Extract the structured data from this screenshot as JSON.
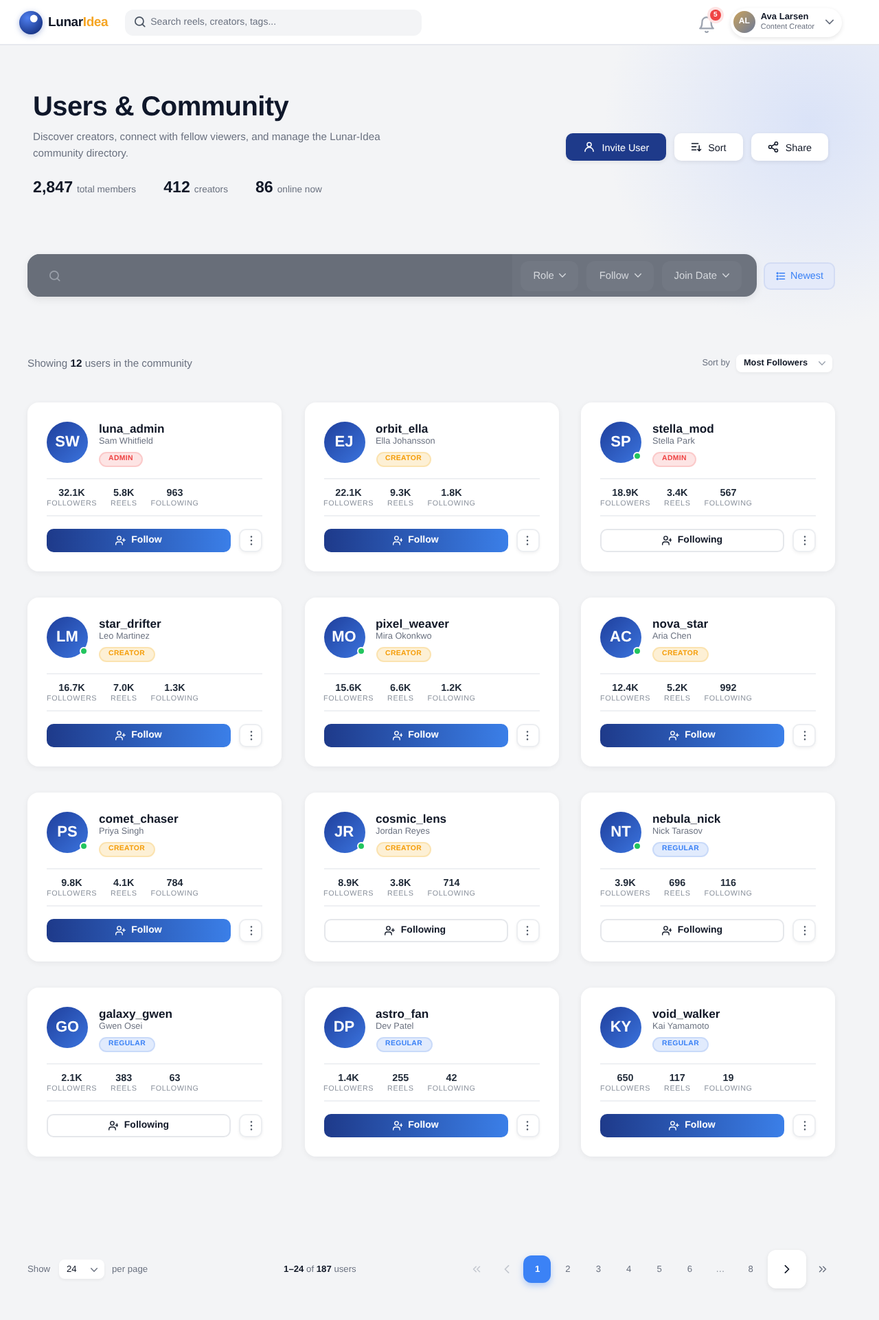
{
  "header": {
    "logo": {
      "name": "Lunar",
      "accent": "Idea"
    },
    "search": {
      "placeholder": "Search reels, creators, tags..."
    },
    "notifications": {
      "count": "5"
    },
    "user": {
      "initials": "AL",
      "name": "Ava Larsen",
      "role": "Content Creator"
    }
  },
  "hero": {
    "title": "Users & Community",
    "subtitle": "Discover creators, connect with fellow viewers, and manage the Lunar-Idea community directory.",
    "stats": [
      {
        "value": "2,847",
        "label": "total members"
      },
      {
        "value": "412",
        "label": "creators"
      },
      {
        "value": "86",
        "label": "online now"
      }
    ],
    "actions": [
      {
        "kind": "invite",
        "label": "Invite User"
      },
      {
        "kind": "sort",
        "label": "Sort"
      },
      {
        "kind": "share",
        "label": "Share"
      }
    ]
  },
  "filters": {
    "dropdowns": [
      {
        "label": "Role"
      },
      {
        "label": "Follow"
      },
      {
        "label": "Join Date"
      }
    ],
    "order_button": {
      "label": "Newest"
    }
  },
  "results": {
    "summary": "Showing **12** users in the community",
    "sort_label": "Sort by",
    "sort_value": "Most Followers"
  },
  "users": [
    {
      "initials": "SW",
      "username": "luna_admin",
      "name": "Sam Whitfield",
      "badge": {
        "label": "ADMIN",
        "kind": "admin"
      },
      "online": false,
      "stats": [
        {
          "value": "32.1K",
          "label": "FOLLOWERS"
        },
        {
          "value": "5.8K",
          "label": "REELS"
        },
        {
          "value": "963",
          "label": "FOLLOWING"
        }
      ],
      "following": false,
      "follow_label": "Follow"
    },
    {
      "initials": "EJ",
      "username": "orbit_ella",
      "name": "Ella Johansson",
      "badge": {
        "label": "CREATOR",
        "kind": "creator"
      },
      "online": false,
      "stats": [
        {
          "value": "22.1K",
          "label": "FOLLOWERS"
        },
        {
          "value": "9.3K",
          "label": "REELS"
        },
        {
          "value": "1.8K",
          "label": "FOLLOWING"
        }
      ],
      "following": false,
      "follow_label": "Follow"
    },
    {
      "initials": "SP",
      "username": "stella_mod",
      "name": "Stella Park",
      "badge": {
        "label": "ADMIN",
        "kind": "admin"
      },
      "online": true,
      "stats": [
        {
          "value": "18.9K",
          "label": "FOLLOWERS"
        },
        {
          "value": "3.4K",
          "label": "REELS"
        },
        {
          "value": "567",
          "label": "FOLLOWING"
        }
      ],
      "following": true,
      "follow_label": "Following"
    },
    {
      "initials": "LM",
      "username": "star_drifter",
      "name": "Leo Martinez",
      "badge": {
        "label": "CREATOR",
        "kind": "creator"
      },
      "online": true,
      "stats": [
        {
          "value": "16.7K",
          "label": "FOLLOWERS"
        },
        {
          "value": "7.0K",
          "label": "REELS"
        },
        {
          "value": "1.3K",
          "label": "FOLLOWING"
        }
      ],
      "following": false,
      "follow_label": "Follow"
    },
    {
      "initials": "MO",
      "username": "pixel_weaver",
      "name": "Mira Okonkwo",
      "badge": {
        "label": "CREATOR",
        "kind": "creator"
      },
      "online": true,
      "stats": [
        {
          "value": "15.6K",
          "label": "FOLLOWERS"
        },
        {
          "value": "6.6K",
          "label": "REELS"
        },
        {
          "value": "1.2K",
          "label": "FOLLOWING"
        }
      ],
      "following": false,
      "follow_label": "Follow"
    },
    {
      "initials": "AC",
      "username": "nova_star",
      "name": "Aria Chen",
      "badge": {
        "label": "CREATOR",
        "kind": "creator"
      },
      "online": true,
      "stats": [
        {
          "value": "12.4K",
          "label": "FOLLOWERS"
        },
        {
          "value": "5.2K",
          "label": "REELS"
        },
        {
          "value": "992",
          "label": "FOLLOWING"
        }
      ],
      "following": false,
      "follow_label": "Follow"
    },
    {
      "initials": "PS",
      "username": "comet_chaser",
      "name": "Priya Singh",
      "badge": {
        "label": "CREATOR",
        "kind": "creator"
      },
      "online": true,
      "stats": [
        {
          "value": "9.8K",
          "label": "FOLLOWERS"
        },
        {
          "value": "4.1K",
          "label": "REELS"
        },
        {
          "value": "784",
          "label": "FOLLOWING"
        }
      ],
      "following": false,
      "follow_label": "Follow"
    },
    {
      "initials": "JR",
      "username": "cosmic_lens",
      "name": "Jordan Reyes",
      "badge": {
        "label": "CREATOR",
        "kind": "creator"
      },
      "online": true,
      "stats": [
        {
          "value": "8.9K",
          "label": "FOLLOWERS"
        },
        {
          "value": "3.8K",
          "label": "REELS"
        },
        {
          "value": "714",
          "label": "FOLLOWING"
        }
      ],
      "following": true,
      "follow_label": "Following"
    },
    {
      "initials": "NT",
      "username": "nebula_nick",
      "name": "Nick Tarasov",
      "badge": {
        "label": "REGULAR",
        "kind": "regular"
      },
      "online": true,
      "stats": [
        {
          "value": "3.9K",
          "label": "FOLLOWERS"
        },
        {
          "value": "696",
          "label": "REELS"
        },
        {
          "value": "116",
          "label": "FOLLOWING"
        }
      ],
      "following": true,
      "follow_label": "Following"
    },
    {
      "initials": "GO",
      "username": "galaxy_gwen",
      "name": "Gwen Osei",
      "badge": {
        "label": "REGULAR",
        "kind": "regular"
      },
      "online": false,
      "stats": [
        {
          "value": "2.1K",
          "label": "FOLLOWERS"
        },
        {
          "value": "383",
          "label": "REELS"
        },
        {
          "value": "63",
          "label": "FOLLOWING"
        }
      ],
      "following": true,
      "follow_label": "Following"
    },
    {
      "initials": "DP",
      "username": "astro_fan",
      "name": "Dev Patel",
      "badge": {
        "label": "REGULAR",
        "kind": "regular"
      },
      "online": false,
      "stats": [
        {
          "value": "1.4K",
          "label": "FOLLOWERS"
        },
        {
          "value": "255",
          "label": "REELS"
        },
        {
          "value": "42",
          "label": "FOLLOWING"
        }
      ],
      "following": false,
      "follow_label": "Follow"
    },
    {
      "initials": "KY",
      "username": "void_walker",
      "name": "Kai Yamamoto",
      "badge": {
        "label": "REGULAR",
        "kind": "regular"
      },
      "online": false,
      "stats": [
        {
          "value": "650",
          "label": "FOLLOWERS"
        },
        {
          "value": "117",
          "label": "REELS"
        },
        {
          "value": "19",
          "label": "FOLLOWING"
        }
      ],
      "following": false,
      "follow_label": "Follow"
    }
  ],
  "pagination": {
    "show_label": "Show",
    "per_page": "24",
    "per_page_label": "per page",
    "range": "**1–24** of **187** users",
    "nav_start": [
      {
        "kind": "first",
        "disabled": true
      },
      {
        "kind": "prev",
        "disabled": true
      }
    ],
    "pages": [
      {
        "kind": "page",
        "label": "1",
        "selected": true
      },
      {
        "kind": "page",
        "label": "2",
        "selected": false
      },
      {
        "kind": "page",
        "label": "3",
        "selected": false
      },
      {
        "kind": "page",
        "label": "4",
        "selected": false
      },
      {
        "kind": "page",
        "label": "5",
        "selected": false
      },
      {
        "kind": "page",
        "label": "6",
        "selected": false
      },
      {
        "kind": "ellipsis",
        "label": "…",
        "selected": false
      },
      {
        "kind": "page",
        "label": "8",
        "selected": false
      }
    ],
    "nav_end": [
      {
        "kind": "next",
        "disabled": false
      },
      {
        "kind": "last",
        "disabled": false
      }
    ]
  }
}
